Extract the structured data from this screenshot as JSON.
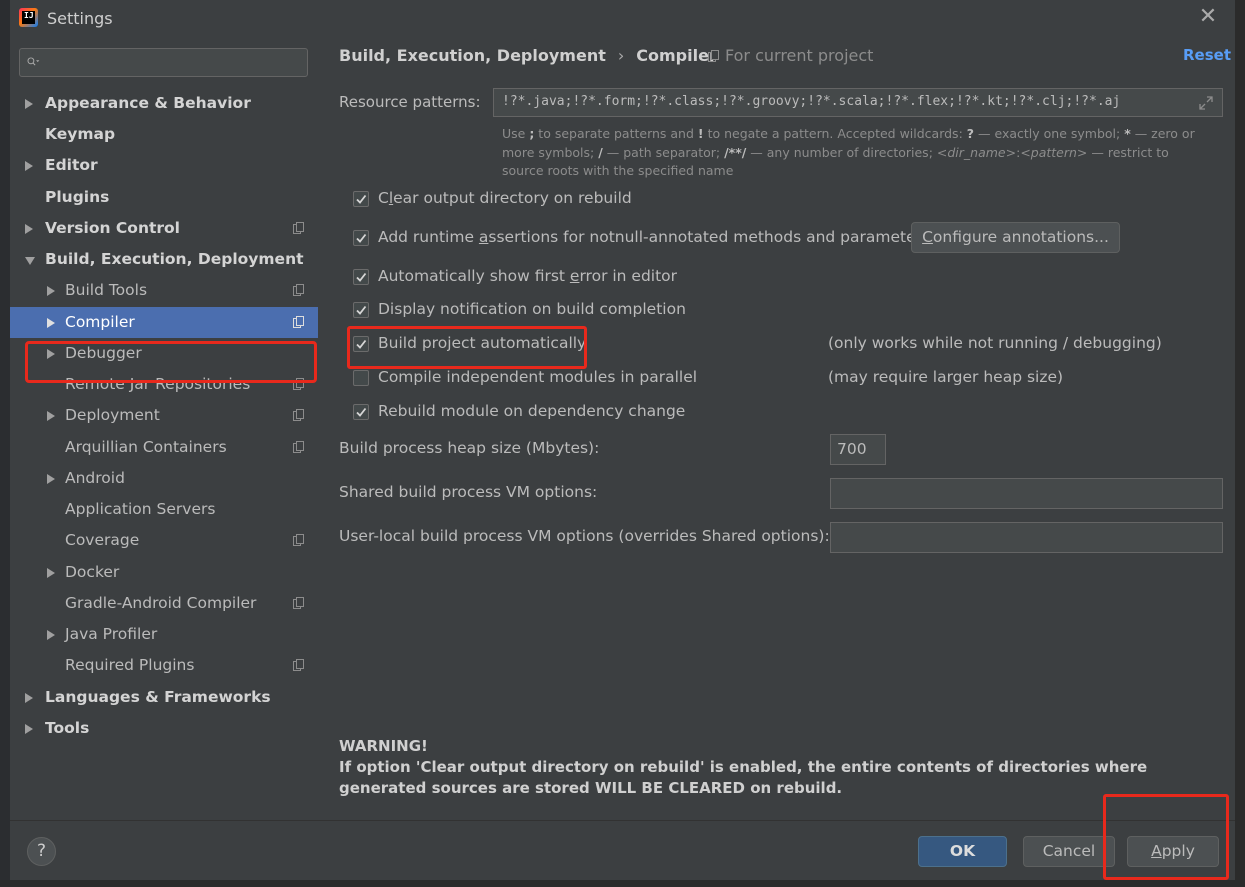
{
  "window": {
    "title": "Settings",
    "app_icon": "intellij-idea-logo",
    "close_icon": "close-icon",
    "close_glyph": "✕"
  },
  "sidebar": {
    "search": {
      "value": "",
      "placeholder": ""
    },
    "items": [
      {
        "label": "Appearance & Behavior",
        "bold": true,
        "arrow": "right",
        "project_icon": false
      },
      {
        "label": "Keymap",
        "bold": true,
        "arrow": "none",
        "project_icon": false
      },
      {
        "label": "Editor",
        "bold": true,
        "arrow": "right",
        "project_icon": false
      },
      {
        "label": "Plugins",
        "bold": true,
        "arrow": "none",
        "project_icon": false
      },
      {
        "label": "Version Control",
        "bold": true,
        "arrow": "right",
        "project_icon": true
      },
      {
        "label": "Build, Execution, Deployment",
        "bold": true,
        "arrow": "down",
        "project_icon": false
      },
      {
        "label": "Build Tools",
        "bold": false,
        "arrow": "right",
        "project_icon": true
      },
      {
        "label": "Compiler",
        "bold": false,
        "arrow": "right",
        "project_icon": true,
        "selected": true
      },
      {
        "label": "Debugger",
        "bold": false,
        "arrow": "right",
        "project_icon": false
      },
      {
        "label": "Remote Jar Repositories",
        "bold": false,
        "arrow": "none",
        "project_icon": true
      },
      {
        "label": "Deployment",
        "bold": false,
        "arrow": "right",
        "project_icon": true
      },
      {
        "label": "Arquillian Containers",
        "bold": false,
        "arrow": "none",
        "project_icon": true
      },
      {
        "label": "Android",
        "bold": false,
        "arrow": "right",
        "project_icon": false
      },
      {
        "label": "Application Servers",
        "bold": false,
        "arrow": "none",
        "project_icon": false
      },
      {
        "label": "Coverage",
        "bold": false,
        "arrow": "none",
        "project_icon": true
      },
      {
        "label": "Docker",
        "bold": false,
        "arrow": "right",
        "project_icon": false
      },
      {
        "label": "Gradle-Android Compiler",
        "bold": false,
        "arrow": "none",
        "project_icon": true
      },
      {
        "label": "Java Profiler",
        "bold": false,
        "arrow": "right",
        "project_icon": false
      },
      {
        "label": "Required Plugins",
        "bold": false,
        "arrow": "none",
        "project_icon": true
      },
      {
        "label": "Languages & Frameworks",
        "bold": true,
        "arrow": "right",
        "project_icon": false
      },
      {
        "label": "Tools",
        "bold": true,
        "arrow": "right",
        "project_icon": false
      }
    ]
  },
  "main": {
    "breadcrumb": {
      "parent": "Build, Execution, Deployment",
      "separator": "›",
      "current": "Compiler"
    },
    "scope": "For current project",
    "reset": "Reset",
    "resource_patterns": {
      "label": "Resource patterns:",
      "value": "!?*.java;!?*.form;!?*.class;!?*.groovy;!?*.scala;!?*.flex;!?*.kt;!?*.clj;!?*.aj",
      "hint": {
        "p1": "Use ",
        "k1": ";",
        "p2": " to separate patterns and ",
        "k2": "!",
        "p3": " to negate a pattern. Accepted wildcards: ",
        "k3": "?",
        "p4": " — exactly one symbol; ",
        "k4": "*",
        "p5": " — zero or more symbols; ",
        "k5": "/",
        "p6": " — path separator; ",
        "k6": "/**/",
        "p7": " — any number of directories; ",
        "k7": "<dir_name>",
        "p8": ":",
        "k8": "<pattern>",
        "p9": " — restrict to source roots with the specified name"
      }
    },
    "options": [
      {
        "pre": "C",
        "u": "l",
        "post": "ear output directory on rebuild",
        "checked": true
      },
      {
        "pre": "Add runtime ",
        "u": "a",
        "post": "ssertions for notnull-annotated methods and parameters",
        "checked": true
      },
      {
        "pre": "Automatically show first ",
        "u": "e",
        "post": "rror in editor",
        "checked": true
      },
      {
        "pre": "Display notification on build completion",
        "u": "",
        "post": "",
        "checked": true
      },
      {
        "pre": "Build project automatically",
        "u": "",
        "post": "",
        "checked": true,
        "note": "(only works while not running / debugging)"
      },
      {
        "pre": "Compile independent modules in parallel",
        "u": "",
        "post": "",
        "checked": false,
        "note": "(may require larger heap size)"
      },
      {
        "pre": "Rebuild module on dependency change",
        "u": "",
        "post": "",
        "checked": true
      }
    ],
    "configure_button": {
      "pre": "",
      "u": "C",
      "post": "onfigure annotations..."
    },
    "heap": {
      "label": "Build process heap size (Mbytes):",
      "value": "700"
    },
    "shared_vm": {
      "label": "Shared build process VM options:",
      "value": ""
    },
    "user_vm": {
      "label": "User-local build process VM options (overrides Shared options):",
      "value": ""
    },
    "warning": {
      "title": "WARNING!",
      "body": "If option 'Clear output directory on rebuild' is enabled, the entire contents of directories where generated sources are stored WILL BE CLEARED on rebuild."
    }
  },
  "footer": {
    "help": "?",
    "ok": "OK",
    "cancel": "Cancel",
    "apply": {
      "pre": "",
      "u": "A",
      "post": "pply"
    }
  },
  "colors": {
    "background": "#3c3f41",
    "selection": "#4b6eaf",
    "link": "#589df6",
    "ok_button": "#365880",
    "annotation_red": "#e8291c"
  }
}
